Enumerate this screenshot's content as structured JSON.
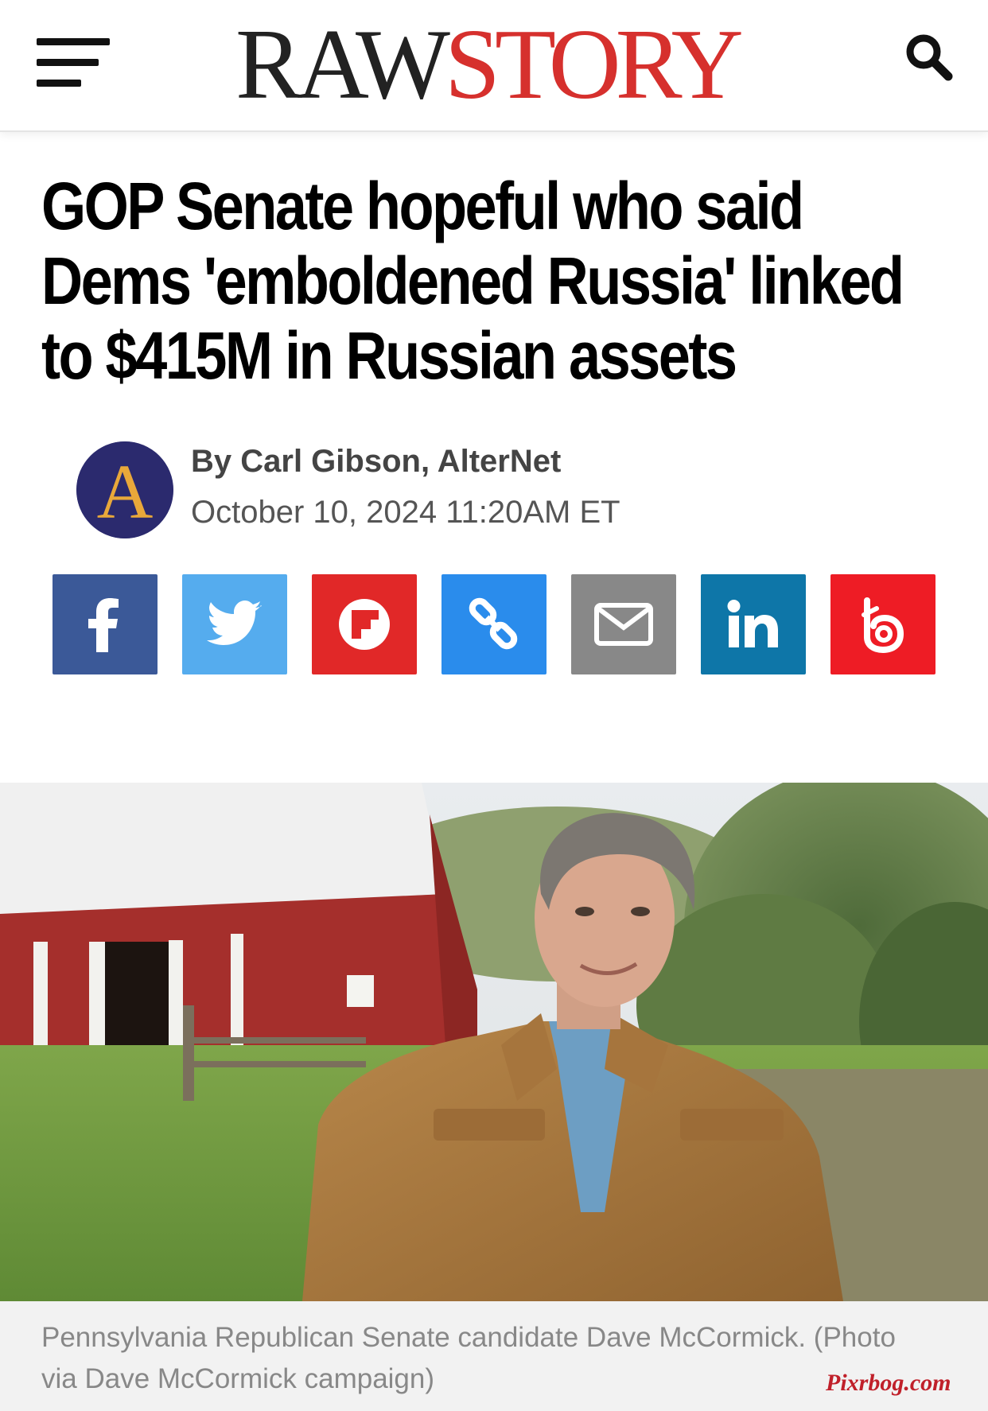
{
  "header": {
    "logo_raw": "RAW",
    "logo_story": "STORY"
  },
  "article": {
    "headline": "GOP Senate hopeful who said Dems 'emboldened Russia' linked to $415M in Russian assets",
    "byline": "By Carl Gibson, AlterNet",
    "date": "October 10, 2024 11:20AM ET",
    "avatar_letter": "A"
  },
  "share_buttons": [
    {
      "name": "facebook",
      "color": "#3b5998",
      "icon": "facebook-icon"
    },
    {
      "name": "twitter",
      "color": "#55acee",
      "icon": "twitter-icon"
    },
    {
      "name": "flipboard",
      "color": "#e12828",
      "icon": "flipboard-icon"
    },
    {
      "name": "copy-link",
      "color": "#2a8cec",
      "icon": "link-icon"
    },
    {
      "name": "email",
      "color": "#888888",
      "icon": "envelope-icon"
    },
    {
      "name": "linkedin",
      "color": "#0e76a8",
      "icon": "linkedin-icon"
    },
    {
      "name": "beebom",
      "color": "#ee1c25",
      "icon": "b-icon"
    }
  ],
  "photo": {
    "caption": "Pennsylvania Republican Senate candidate Dave McCormick. (Photo via Dave McCormick campaign)"
  },
  "watermark": "Pixrbog.com",
  "colors": {
    "brand_red": "#d6302d",
    "logo_dark": "#222222"
  }
}
